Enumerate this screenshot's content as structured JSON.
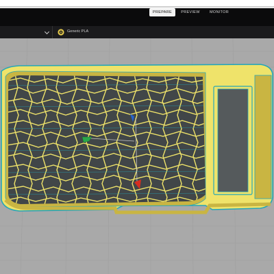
{
  "header": {
    "stages": [
      {
        "label": "PREPARE",
        "active": true
      },
      {
        "label": "PREVIEW",
        "active": false
      },
      {
        "label": "MONITOR",
        "active": false
      }
    ]
  },
  "config": {
    "material_label": "Generic PLA",
    "material_icon": "spool-icon"
  },
  "colors": {
    "topbar": "#0b0b0c",
    "config_bar": "#1b1b1d",
    "viewport_bg": "#a9a9a9",
    "model_wall": "#efe36a",
    "model_wall_dark": "#c9b542",
    "outline": "#25a6b8",
    "cell_fill": "#414648",
    "axis_x": "#d62d20",
    "axis_y": "#2aa84a",
    "axis_z": "#2463d0"
  }
}
